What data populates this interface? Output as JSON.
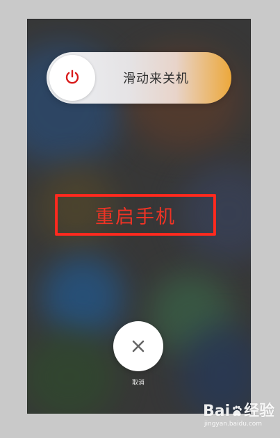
{
  "slider": {
    "label": "滑动来关机",
    "icon": "power-icon",
    "accent": "#d91b1b",
    "gradient_end": "#f5ae3c"
  },
  "restart": {
    "label": "重启手机",
    "text_color": "#f03325",
    "box_color": "#ff2a1f"
  },
  "cancel": {
    "label": "取消",
    "icon": "close-icon",
    "icon_color": "#666666"
  },
  "watermark": {
    "brand_left": "Bai",
    "brand_right": "经验",
    "url": "jingyan.baidu.com",
    "icon": "paw-icon"
  }
}
